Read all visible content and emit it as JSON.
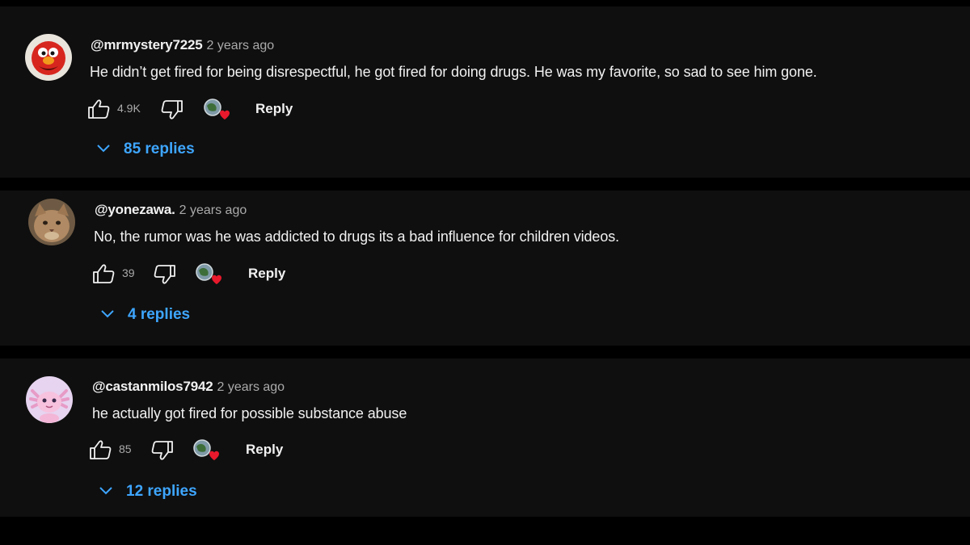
{
  "colors": {
    "background": "#000000",
    "card": "#0f0f0f",
    "text": "#f1f1f1",
    "muted": "#aaaaaa",
    "link": "#3ea6ff",
    "heart": "#e8192c"
  },
  "icons": {
    "like": "thumbs-up-icon",
    "dislike": "thumbs-down-icon",
    "creator_heart": "creator-heart-icon",
    "expand": "chevron-down-icon"
  },
  "comments": [
    {
      "author": "@mrmystery7225",
      "time": "2 years ago",
      "text": "He didn’t get fired for being disrespectful, he got fired for doing drugs. He was my favorite, so sad to see him gone.",
      "likes": "4.9K",
      "reply_label": "Reply",
      "replies_label": "85 replies",
      "avatar": "red-puppet-avatar"
    },
    {
      "author": "@yonezawa.",
      "time": "2 years ago",
      "text": "No, the rumor was he was addicted to drugs its a bad influence for children videos.",
      "likes": "39",
      "reply_label": "Reply",
      "replies_label": "4 replies",
      "avatar": "cat-photo-avatar"
    },
    {
      "author": "@castanmilos7942",
      "time": "2 years ago",
      "text": "he actually got fired for possible substance abuse",
      "likes": "85",
      "reply_label": "Reply",
      "replies_label": "12 replies",
      "avatar": "pink-axolotl-avatar"
    }
  ]
}
